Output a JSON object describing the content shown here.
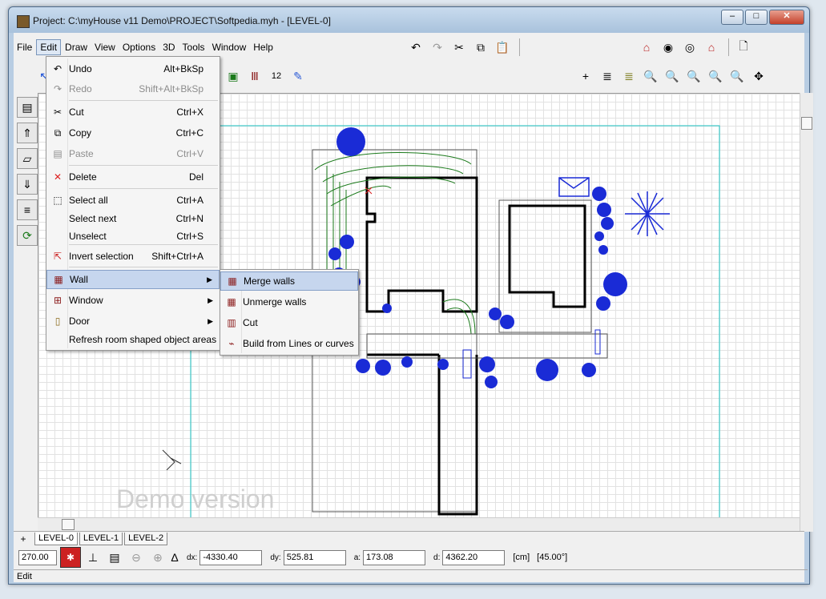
{
  "window": {
    "title": "Project: C:\\myHouse v11 Demo\\PROJECT\\Softpedia.myh - [LEVEL-0]"
  },
  "menubar": [
    "File",
    "Edit",
    "Draw",
    "View",
    "Options",
    "3D",
    "Tools",
    "Window",
    "Help"
  ],
  "edit_menu": [
    {
      "label": "Undo",
      "shortcut": "Alt+BkSp",
      "icon": "undo-icon"
    },
    {
      "label": "Redo",
      "shortcut": "Shift+Alt+BkSp",
      "icon": "redo-icon",
      "disabled": true
    },
    {
      "label": "Cut",
      "shortcut": "Ctrl+X",
      "icon": "scissors-icon"
    },
    {
      "label": "Copy",
      "shortcut": "Ctrl+C",
      "icon": "copy-icon"
    },
    {
      "label": "Paste",
      "shortcut": "Ctrl+V",
      "icon": "paste-icon",
      "disabled": true
    },
    {
      "label": "Delete",
      "shortcut": "Del",
      "icon": "delete-icon"
    },
    {
      "label": "Select all",
      "shortcut": "Ctrl+A",
      "icon": "select-all-icon"
    },
    {
      "label": "Select next",
      "shortcut": "Ctrl+N"
    },
    {
      "label": "Unselect",
      "shortcut": "Ctrl+S"
    },
    {
      "label": "Invert selection",
      "shortcut": "Shift+Ctrl+A",
      "icon": "invert-selection-icon"
    },
    {
      "label": "Wall",
      "submenu": true,
      "icon": "wall-icon"
    },
    {
      "label": "Window",
      "submenu": true,
      "icon": "window-icon"
    },
    {
      "label": "Door",
      "submenu": true,
      "icon": "door-icon"
    },
    {
      "label": "Refresh room shaped object areas"
    }
  ],
  "wall_submenu": [
    {
      "label": "Merge walls",
      "icon": "merge-walls-icon"
    },
    {
      "label": "Unmerge walls",
      "icon": "unmerge-walls-icon"
    },
    {
      "label": "Cut",
      "icon": "cut-wall-icon"
    },
    {
      "label": "Build from Lines or curves",
      "icon": "build-lines-icon"
    }
  ],
  "canvas": {
    "watermark": "Demo version",
    "angle_label": "12"
  },
  "level_tabs": [
    "LEVEL-0",
    "LEVEL-1",
    "LEVEL-2"
  ],
  "add_level": "+",
  "coords": {
    "angle": "270.00",
    "dx_label": "dx:",
    "dx": "-4330.40",
    "dy_label": "dy:",
    "dy": "525.81",
    "a_label": "a:",
    "a": "173.08",
    "d_label": "d:",
    "d": "4362.20",
    "unit": "[cm]",
    "snap_angle": "[45.00°]"
  },
  "status": "Edit",
  "colors": {
    "menu_highlight": "#c6d6ee",
    "plan_green": "#1b7a1b",
    "plan_blue": "#1a2bd6"
  }
}
